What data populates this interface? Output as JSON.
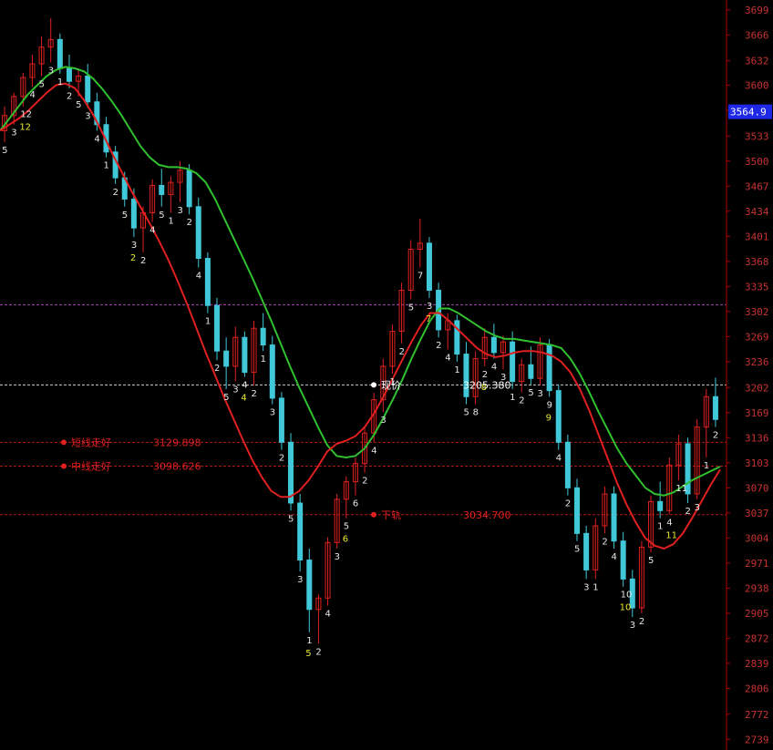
{
  "chart_data": {
    "type": "candlestick",
    "y_axis": {
      "ticks": [
        "3699",
        "3666",
        "3632",
        "3600",
        "3567",
        "3533",
        "3500",
        "3467",
        "3434",
        "3401",
        "3368",
        "3335",
        "3302",
        "3269",
        "3236",
        "3202",
        "3169",
        "3136",
        "3103",
        "3070",
        "3037",
        "3004",
        "2971",
        "2938",
        "2905",
        "2872",
        "2839",
        "2806",
        "2772",
        "2739"
      ],
      "ylim": [
        2725,
        3712
      ],
      "position": "right"
    },
    "current_price": "3564.9",
    "levels": [
      {
        "label": "短线走好",
        "value": "3129.898",
        "price": 3129.9,
        "color": "#e02020"
      },
      {
        "label": "中线走好",
        "value": "3098.626",
        "price": 3098.6,
        "color": "#e02020"
      },
      {
        "label": "下轨",
        "value": "3034.700",
        "price": 3034.7,
        "color": "#e02020"
      },
      {
        "label": "现价",
        "value": "3205.380",
        "price": 3205.4,
        "color": "#ffffff"
      }
    ],
    "ref_line": {
      "price": 3311,
      "color": "#b040c0"
    },
    "moving_averages": [
      {
        "color": "#30c030",
        "values": [
          3540,
          3556,
          3572,
          3588,
          3600,
          3612,
          3620,
          3624,
          3622,
          3618,
          3608,
          3594,
          3578,
          3560,
          3540,
          3520,
          3505,
          3495,
          3492,
          3492,
          3490,
          3484,
          3472,
          3450,
          3424,
          3398,
          3372,
          3346,
          3318,
          3290,
          3260,
          3230,
          3202,
          3176,
          3150,
          3126,
          3112,
          3110,
          3112,
          3122,
          3140,
          3162,
          3186,
          3212,
          3240,
          3266,
          3290,
          3306,
          3306,
          3300,
          3292,
          3284,
          3276,
          3270,
          3266,
          3266,
          3264,
          3262,
          3260,
          3258,
          3254,
          3240,
          3220,
          3196,
          3170,
          3146,
          3122,
          3102,
          3086,
          3070,
          3062,
          3060,
          3064,
          3072,
          3080,
          3086,
          3092,
          3098
        ]
      },
      {
        "color": "#e02020",
        "values": [
          3540,
          3548,
          3556,
          3566,
          3578,
          3590,
          3600,
          3602,
          3596,
          3580,
          3560,
          3536,
          3510,
          3486,
          3462,
          3440,
          3418,
          3395,
          3370,
          3342,
          3312,
          3280,
          3248,
          3218,
          3188,
          3160,
          3132,
          3106,
          3084,
          3066,
          3058,
          3058,
          3066,
          3080,
          3098,
          3118,
          3128,
          3132,
          3138,
          3150,
          3168,
          3190,
          3214,
          3238,
          3262,
          3284,
          3300,
          3300,
          3290,
          3278,
          3266,
          3254,
          3246,
          3242,
          3244,
          3248,
          3250,
          3250,
          3248,
          3244,
          3236,
          3222,
          3200,
          3172,
          3140,
          3108,
          3076,
          3048,
          3024,
          3004,
          2994,
          2990,
          2996,
          3010,
          3030,
          3052,
          3074,
          3094
        ]
      }
    ],
    "candles": [
      [
        3540,
        3572,
        3525,
        3560
      ],
      [
        3560,
        3590,
        3548,
        3585
      ],
      [
        3585,
        3616,
        3572,
        3610
      ],
      [
        3610,
        3640,
        3598,
        3628
      ],
      [
        3628,
        3664,
        3612,
        3650
      ],
      [
        3650,
        3688,
        3630,
        3660
      ],
      [
        3660,
        3668,
        3615,
        3622
      ],
      [
        3622,
        3640,
        3596,
        3605
      ],
      [
        3605,
        3622,
        3585,
        3612
      ],
      [
        3612,
        3628,
        3570,
        3578
      ],
      [
        3578,
        3590,
        3540,
        3548
      ],
      [
        3548,
        3558,
        3505,
        3512
      ],
      [
        3512,
        3520,
        3470,
        3478
      ],
      [
        3478,
        3486,
        3440,
        3450
      ],
      [
        3450,
        3464,
        3400,
        3412
      ],
      [
        3412,
        3440,
        3380,
        3432
      ],
      [
        3432,
        3476,
        3420,
        3468
      ],
      [
        3468,
        3490,
        3440,
        3456
      ],
      [
        3456,
        3480,
        3432,
        3472
      ],
      [
        3472,
        3500,
        3446,
        3488
      ],
      [
        3488,
        3496,
        3430,
        3440
      ],
      [
        3440,
        3452,
        3360,
        3372
      ],
      [
        3372,
        3380,
        3300,
        3310
      ],
      [
        3310,
        3320,
        3238,
        3250
      ],
      [
        3250,
        3268,
        3200,
        3230
      ],
      [
        3230,
        3282,
        3210,
        3268
      ],
      [
        3268,
        3276,
        3216,
        3222
      ],
      [
        3222,
        3290,
        3205,
        3280
      ],
      [
        3280,
        3300,
        3250,
        3258
      ],
      [
        3258,
        3270,
        3180,
        3188
      ],
      [
        3188,
        3196,
        3120,
        3130
      ],
      [
        3130,
        3142,
        3040,
        3050
      ],
      [
        3050,
        3062,
        2960,
        2975
      ],
      [
        2975,
        2990,
        2880,
        2910
      ],
      [
        2910,
        2930,
        2865,
        2925
      ],
      [
        2925,
        3005,
        2915,
        2998
      ],
      [
        2998,
        3062,
        2990,
        3055
      ],
      [
        3055,
        3085,
        3030,
        3078
      ],
      [
        3078,
        3110,
        3060,
        3102
      ],
      [
        3102,
        3150,
        3090,
        3142
      ],
      [
        3142,
        3195,
        3130,
        3186
      ],
      [
        3186,
        3240,
        3170,
        3230
      ],
      [
        3230,
        3285,
        3220,
        3276
      ],
      [
        3276,
        3340,
        3260,
        3330
      ],
      [
        3330,
        3396,
        3318,
        3384
      ],
      [
        3384,
        3424,
        3360,
        3392
      ],
      [
        3392,
        3400,
        3320,
        3330
      ],
      [
        3330,
        3340,
        3268,
        3278
      ],
      [
        3278,
        3300,
        3252,
        3290
      ],
      [
        3290,
        3298,
        3236,
        3246
      ],
      [
        3246,
        3262,
        3180,
        3190
      ],
      [
        3190,
        3250,
        3180,
        3240
      ],
      [
        3240,
        3280,
        3230,
        3268
      ],
      [
        3268,
        3286,
        3240,
        3248
      ],
      [
        3248,
        3270,
        3226,
        3262
      ],
      [
        3262,
        3276,
        3200,
        3210
      ],
      [
        3210,
        3240,
        3196,
        3232
      ],
      [
        3232,
        3256,
        3206,
        3214
      ],
      [
        3214,
        3268,
        3205,
        3258
      ],
      [
        3258,
        3266,
        3190,
        3198
      ],
      [
        3198,
        3206,
        3120,
        3130
      ],
      [
        3130,
        3140,
        3060,
        3070
      ],
      [
        3070,
        3082,
        3000,
        3010
      ],
      [
        3010,
        3020,
        2950,
        2962
      ],
      [
        2962,
        3030,
        2950,
        3020
      ],
      [
        3020,
        3072,
        3010,
        3062
      ],
      [
        3062,
        3072,
        2990,
        3000
      ],
      [
        3000,
        3012,
        2940,
        2950
      ],
      [
        2950,
        2962,
        2900,
        2912
      ],
      [
        2912,
        3000,
        2905,
        2992
      ],
      [
        2992,
        3060,
        2985,
        3052
      ],
      [
        3052,
        3078,
        3030,
        3040
      ],
      [
        3040,
        3110,
        3035,
        3100
      ],
      [
        3100,
        3140,
        3080,
        3128
      ],
      [
        3128,
        3136,
        3050,
        3062
      ],
      [
        3062,
        3160,
        3055,
        3150
      ],
      [
        3150,
        3200,
        3110,
        3190
      ],
      [
        3190,
        3215,
        3150,
        3160
      ]
    ],
    "counts": [
      "5",
      "3",
      "12",
      "4",
      "5",
      "3",
      "1",
      "2",
      "5",
      "3",
      "4",
      "1",
      "2",
      "5",
      "3",
      "2",
      "4",
      "5",
      "1",
      "3",
      "2",
      "4",
      "1",
      "2",
      "5",
      "3",
      "4",
      "2",
      "1",
      "3",
      "2",
      "5",
      "3",
      "1",
      "2",
      "4",
      "3",
      "5",
      "6",
      "2",
      "4",
      "3",
      "1",
      "2",
      "5",
      "7",
      "3",
      "2",
      "4",
      "1",
      "5",
      "8",
      "2",
      "4",
      "3",
      "1",
      "2",
      "5",
      "3",
      "9",
      "4",
      "2",
      "5",
      "3",
      "1",
      "2",
      "4",
      "10",
      "3",
      "2",
      "5",
      "1",
      "4",
      "11",
      "2",
      "3",
      "1",
      "2"
    ],
    "highlight_counts": [
      {
        "text": "12",
        "bar": 2
      },
      {
        "text": "2",
        "bar": 14
      },
      {
        "text": "4",
        "bar": 26
      },
      {
        "text": "5",
        "bar": 33
      },
      {
        "text": "6",
        "bar": 37
      },
      {
        "text": "7",
        "bar": 46
      },
      {
        "text": "8",
        "bar": 52
      },
      {
        "text": "9",
        "bar": 59
      },
      {
        "text": "10",
        "bar": 67
      },
      {
        "text": "11",
        "bar": 72
      }
    ]
  }
}
